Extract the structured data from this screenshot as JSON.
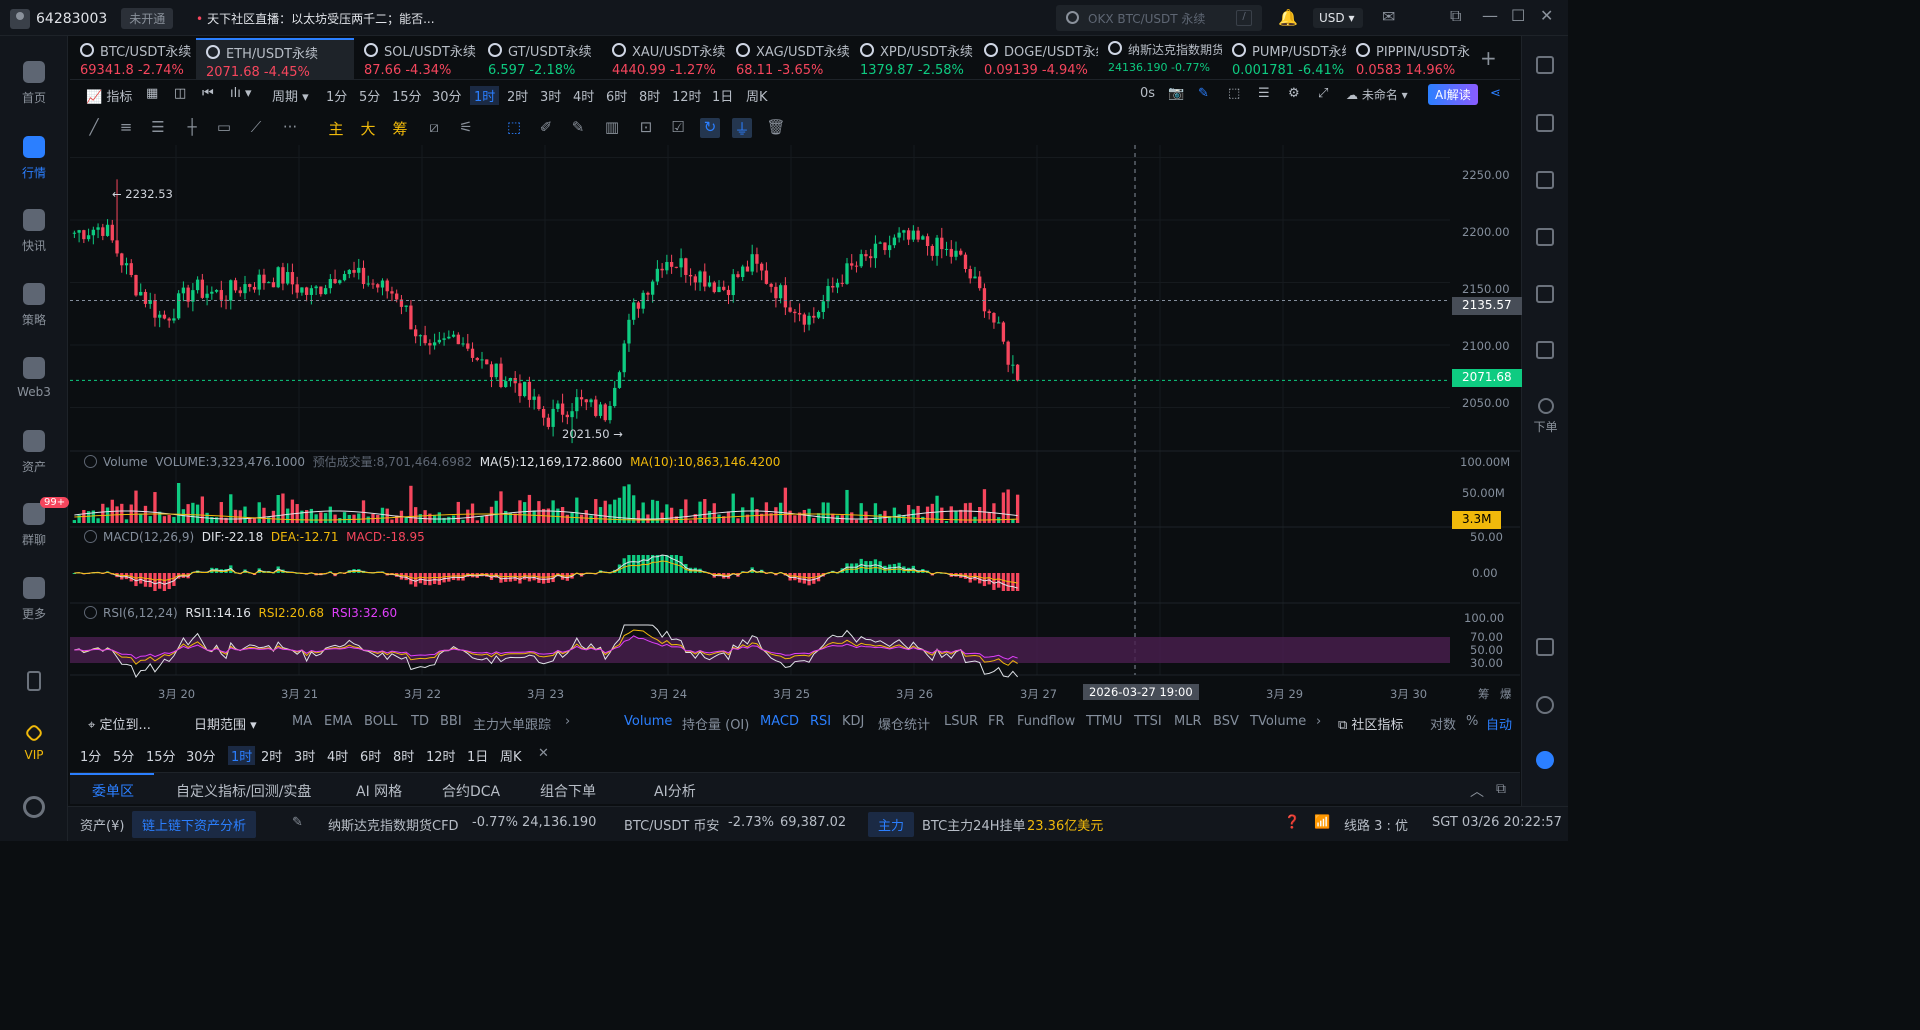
{
  "topbar": {
    "user_id": "64283003",
    "account_status": "未开通",
    "ticker_text": "天下社区直播：以太坊受压两千二；能否...",
    "search_placeholder": "OKX BTC/USDT 永续",
    "search_shortcut": "/",
    "currency": "USD"
  },
  "leftnav": {
    "items": [
      {
        "label": "首页",
        "icon": "home-icon"
      },
      {
        "label": "行情",
        "icon": "market-chart-icon"
      },
      {
        "label": "快讯",
        "icon": "news-icon"
      },
      {
        "label": "策略",
        "icon": "strategy-icon"
      },
      {
        "label": "Web3",
        "icon": "web3-icon"
      },
      {
        "label": "资产",
        "icon": "wallet-icon"
      },
      {
        "label": "群聊",
        "icon": "chat-icon"
      },
      {
        "label": "更多",
        "icon": "more-grid-icon"
      }
    ],
    "chat_badge": "99+",
    "vip_label": "VIP"
  },
  "rightnav": {
    "order_label": "下单"
  },
  "symbol_tabs": [
    {
      "name": "BTC/USDT永续",
      "price": "69341.8",
      "change": "-2.74%",
      "dir": "down"
    },
    {
      "name": "ETH/USDT永续",
      "price": "2071.68",
      "change": "-4.45%",
      "dir": "down",
      "active": true
    },
    {
      "name": "SOL/USDT永续",
      "price": "87.66",
      "change": "-4.34%",
      "dir": "down"
    },
    {
      "name": "GT/USDT永续",
      "price": "6.597",
      "change": "-2.18%",
      "dir": "up"
    },
    {
      "name": "XAU/USDT永续",
      "price": "4440.99",
      "change": "-1.27%",
      "dir": "down"
    },
    {
      "name": "XAG/USDT永续",
      "price": "68.11",
      "change": "-3.65%",
      "dir": "down"
    },
    {
      "name": "XPD/USDT永续",
      "price": "1379.87",
      "change": "-2.58%",
      "dir": "up"
    },
    {
      "name": "DOGE/USDT永续",
      "price": "0.09139",
      "change": "-4.94%",
      "dir": "down"
    },
    {
      "name": "纳斯达克指数期货CFD",
      "price": "24136.190",
      "change": "-0.77%",
      "dir": "up"
    },
    {
      "name": "PUMP/USDT永续",
      "price": "0.001781",
      "change": "-6.41%",
      "dir": "up"
    },
    {
      "name": "PIPPIN/USDT永续",
      "price": "0.0583",
      "change": "14.96%",
      "dir": "down"
    }
  ],
  "interval_bar": {
    "indicator_label": "指标",
    "period_label": "周期",
    "intervals": [
      "1分",
      "5分",
      "15分",
      "30分",
      "1时",
      "2时",
      "3时",
      "4时",
      "6时",
      "8时",
      "12时",
      "1日",
      "周K"
    ],
    "active_interval": "1时",
    "countdown": "0s",
    "layout_name": "未命名",
    "ai_label": "AI解读"
  },
  "chart": {
    "price_axis": [
      "2250.00",
      "2200.00",
      "2150.00",
      "2100.00",
      "2050.00"
    ],
    "crosshair_price": "2135.57",
    "last_price": "2071.68",
    "high_label": "← 2232.53",
    "low_label": "2021.50 →",
    "volume_axis": [
      "100.00M",
      "50.00M"
    ],
    "volume_tag": "3.3M",
    "macd_axis": [
      "50.00",
      "0.00"
    ],
    "rsi_axis": [
      "100.00",
      "70.00",
      "50.00",
      "30.00"
    ],
    "date_axis": [
      "3月 20",
      "3月 21",
      "3月 22",
      "3月 23",
      "3月 24",
      "3月 25",
      "3月 26",
      "3月 27",
      "3月 29",
      "3月 30"
    ],
    "crosshair_time": "2026-03-27 19:00",
    "corner_labels": [
      "筹",
      "爆"
    ],
    "volume_legend": {
      "name": "Volume",
      "value": "VOLUME:3,323,476.1000",
      "est": "预估成交量:8,701,464.6982",
      "ma5": "MA(5):12,169,172.8600",
      "ma10": "MA(10):10,863,146.4200"
    },
    "macd_legend": {
      "name": "MACD(12,26,9)",
      "dif": "DIF:-22.18",
      "dea": "DEA:-12.71",
      "macd": "MACD:-18.95"
    },
    "rsi_legend": {
      "name": "RSI(6,12,24)",
      "rsi1": "RSI1:14.16",
      "rsi2": "RSI2:20.68",
      "rsi3": "RSI3:32.60"
    }
  },
  "chart_data": {
    "type": "candlestick",
    "interval": "1时",
    "x": [
      "3月 20",
      "3月 21",
      "3月 22",
      "3月 23",
      "3月 24",
      "3月 25",
      "3月 26",
      "3月 27"
    ],
    "close_path": [
      2190,
      2195,
      2150,
      2120,
      2145,
      2140,
      2150,
      2155,
      2140,
      2160,
      2150,
      2140,
      2090,
      2110,
      2080,
      2070,
      2040,
      2055,
      2045,
      2130,
      2170,
      2160,
      2145,
      2165,
      2140,
      2120,
      2155,
      2170,
      2185,
      2180,
      2170,
      2130,
      2071.68
    ],
    "high": 2232.53,
    "low": 2021.5,
    "last": 2071.68,
    "ylim": [
      2020,
      2260
    ]
  },
  "indicator_tabs": {
    "locate": "定位到...",
    "date_range": "日期范围",
    "main": [
      "MA",
      "EMA",
      "BOLL",
      "TD",
      "BBI",
      "主力大单跟踪"
    ],
    "sub": [
      "Volume",
      "持仓量 (OI)",
      "MACD",
      "RSI",
      "KDJ",
      "爆仓统计",
      "LSUR",
      "FR",
      "Fundflow",
      "TTMU",
      "TTSI",
      "MLR",
      "BSV",
      "TVolume"
    ],
    "active_sub": [
      "Volume",
      "MACD",
      "RSI"
    ],
    "community": "社区指标",
    "log": "对数",
    "pct": "%",
    "auto": "自动",
    "timeframes": [
      "1分",
      "5分",
      "15分",
      "30分",
      "1时",
      "2时",
      "3时",
      "4时",
      "6时",
      "8时",
      "12时",
      "1日",
      "周K"
    ]
  },
  "bottom_tabs": [
    "委单区",
    "自定义指标/回测/实盘",
    "AI 网格",
    "合约DCA",
    "组合下单",
    "AI分析"
  ],
  "statusbar": {
    "asset_label": "资产(¥)",
    "asset_btn": "链上链下资产分析",
    "nasdaq_name": "纳斯达克指数期货CFD",
    "nasdaq_change": "-0.77%",
    "nasdaq_price": "24,136.190",
    "btc_name": "BTC/USDT 币安",
    "btc_change": "-2.73%",
    "btc_price": "69,387.02",
    "main_label": "主力",
    "main_text": "BTC主力24H挂单",
    "main_value": "23.36亿美元",
    "line_label": "线路 3 : 优",
    "time": "SGT 03/26 20:22:57"
  },
  "colors": {
    "up": "#0ecb81",
    "down": "#f6465d",
    "accent": "#2b7fff",
    "bg": "#0b0e11"
  }
}
